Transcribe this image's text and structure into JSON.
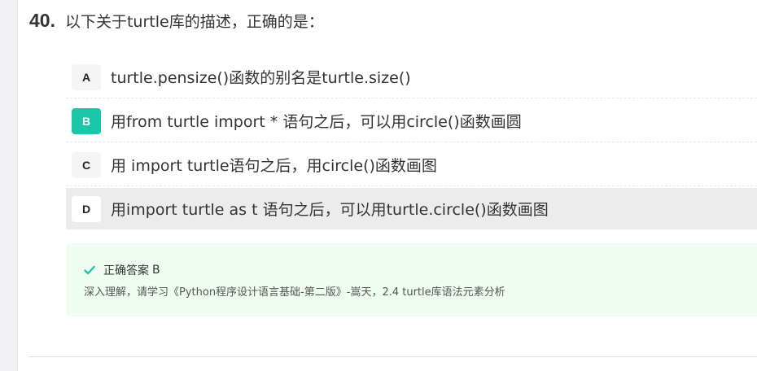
{
  "question": {
    "number": "40.",
    "text": "以下关于turtle库的描述，正确的是："
  },
  "options": [
    {
      "letter": "A",
      "text": "turtle.pensize()函数的别名是turtle.size()"
    },
    {
      "letter": "B",
      "text": "用from turtle import * 语句之后，可以用circle()函数画圆"
    },
    {
      "letter": "C",
      "text": "用 import turtle语句之后，用circle()函数画图"
    },
    {
      "letter": "D",
      "text": "用import turtle as t 语句之后，可以用turtle.circle()函数画图"
    }
  ],
  "answer": {
    "label": "正确答案",
    "value": "B",
    "explanation": "深入理解，请学习《Python程序设计语言基础-第二版》-嵩天，2.4 turtle库语法元素分析",
    "icon": "check-icon",
    "check_color": "#19c7a8"
  },
  "colors": {
    "correct_badge": "#19c7a8",
    "answer_bg": "#effdf0",
    "highlight_row": "#ececec"
  }
}
